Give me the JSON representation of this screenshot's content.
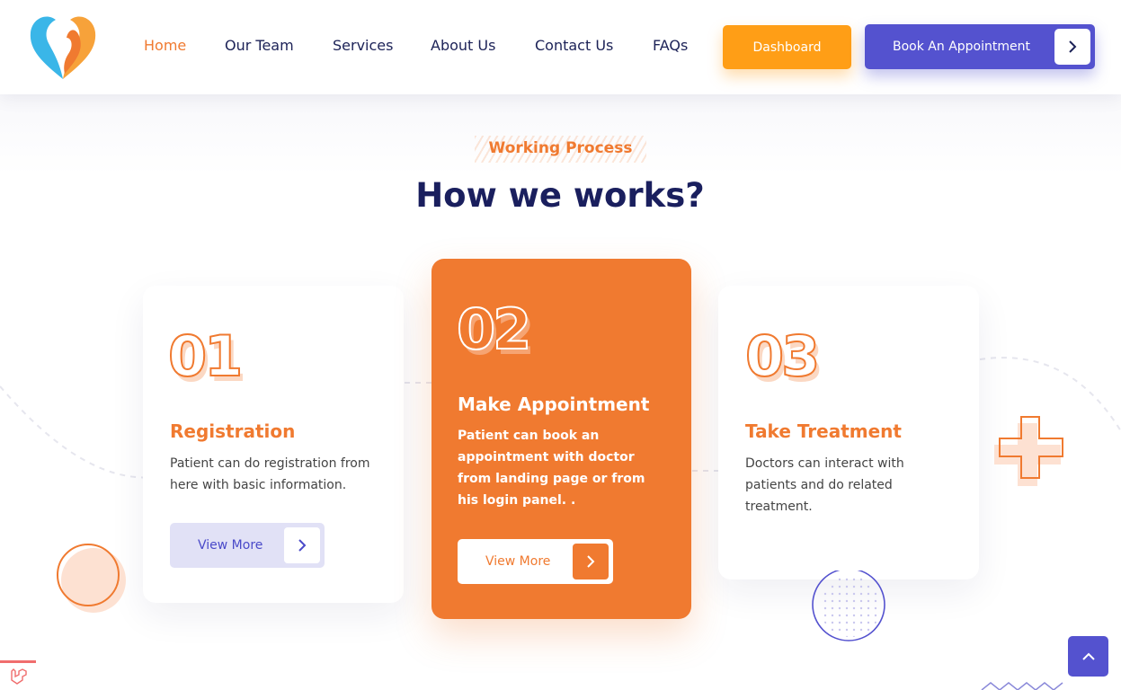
{
  "nav": {
    "logo_icon": "heart-logo-icon",
    "links": [
      "Home",
      "Our Team",
      "Services",
      "About Us",
      "Contact Us",
      "FAQs"
    ],
    "active_index": 0,
    "dashboard_label": "Dashboard",
    "book_label": "Book An Appointment"
  },
  "section": {
    "subtitle": "Working Process",
    "title": "How we works?"
  },
  "cards": [
    {
      "number": "01",
      "title": "Registration",
      "text": "Patient can do registration from here with basic information.",
      "button": "View More"
    },
    {
      "number": "02",
      "title": "Make Appointment",
      "text": "Patient can book an appointment with doctor from landing page or from his login panel. .",
      "button": "View More"
    },
    {
      "number": "03",
      "title": "Take Treatment",
      "text": "Doctors can interact with patients and do related treatment.",
      "button": ""
    }
  ],
  "colors": {
    "accent_orange": "#f07a30",
    "dashboard_orange": "#ff9e16",
    "brand_purple": "#5452cf",
    "heading_navy": "#1a1f5e"
  },
  "icons": {
    "chevron": "chevron-right-icon",
    "scroll_top": "chevron-up-icon"
  }
}
